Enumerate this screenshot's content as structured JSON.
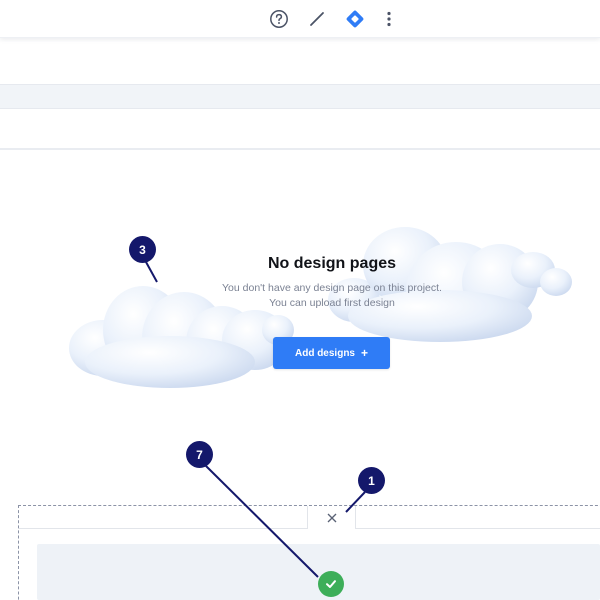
{
  "toolbar": {
    "icons": [
      "help-icon",
      "line-tool-icon",
      "jira-icon",
      "more-vertical-icon"
    ],
    "accent": "#2f7cf6"
  },
  "empty_state": {
    "title": "No design pages",
    "description_line1": "You don't have any design page on this project.",
    "description_line2": "You can upload first design",
    "button_label": "Add designs",
    "button_icon": "+",
    "button_color": "#2f7cf6"
  },
  "panel": {
    "close_icon": "×",
    "status": "success",
    "status_color": "#3dae59"
  },
  "annotations": [
    "3",
    "7",
    "1"
  ]
}
